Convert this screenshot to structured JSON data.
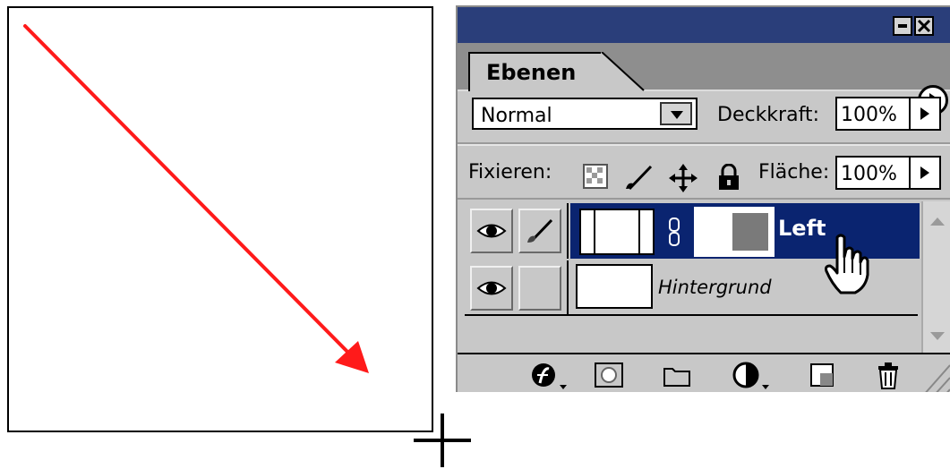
{
  "panel": {
    "tab_label": "Ebenen",
    "blend_mode": "Normal",
    "opacity_label": "Deckkraft:",
    "opacity_value": "100%",
    "lock_label": "Fixieren:",
    "fill_label": "Fläche:",
    "fill_value": "100%"
  },
  "layers": [
    {
      "name": "Left",
      "selected": true,
      "visible": true,
      "has_mask": true
    },
    {
      "name": "Hintergrund",
      "selected": false,
      "visible": true,
      "has_mask": false
    }
  ],
  "colors": {
    "titlebar": "#2a3e7a",
    "selected_layer": "#0a2470",
    "arrow": "#ff1a1a",
    "panel_bg": "#c8c8c8"
  },
  "icons": {
    "lock_transparency": "checkerboard-icon",
    "lock_image": "brush-icon",
    "lock_position": "move-icon",
    "lock_all": "padlock-icon",
    "bottom_toolbar": [
      "layer-style-icon",
      "add-mask-icon",
      "new-set-icon",
      "adjustment-layer-icon",
      "new-layer-icon",
      "trash-icon"
    ]
  }
}
